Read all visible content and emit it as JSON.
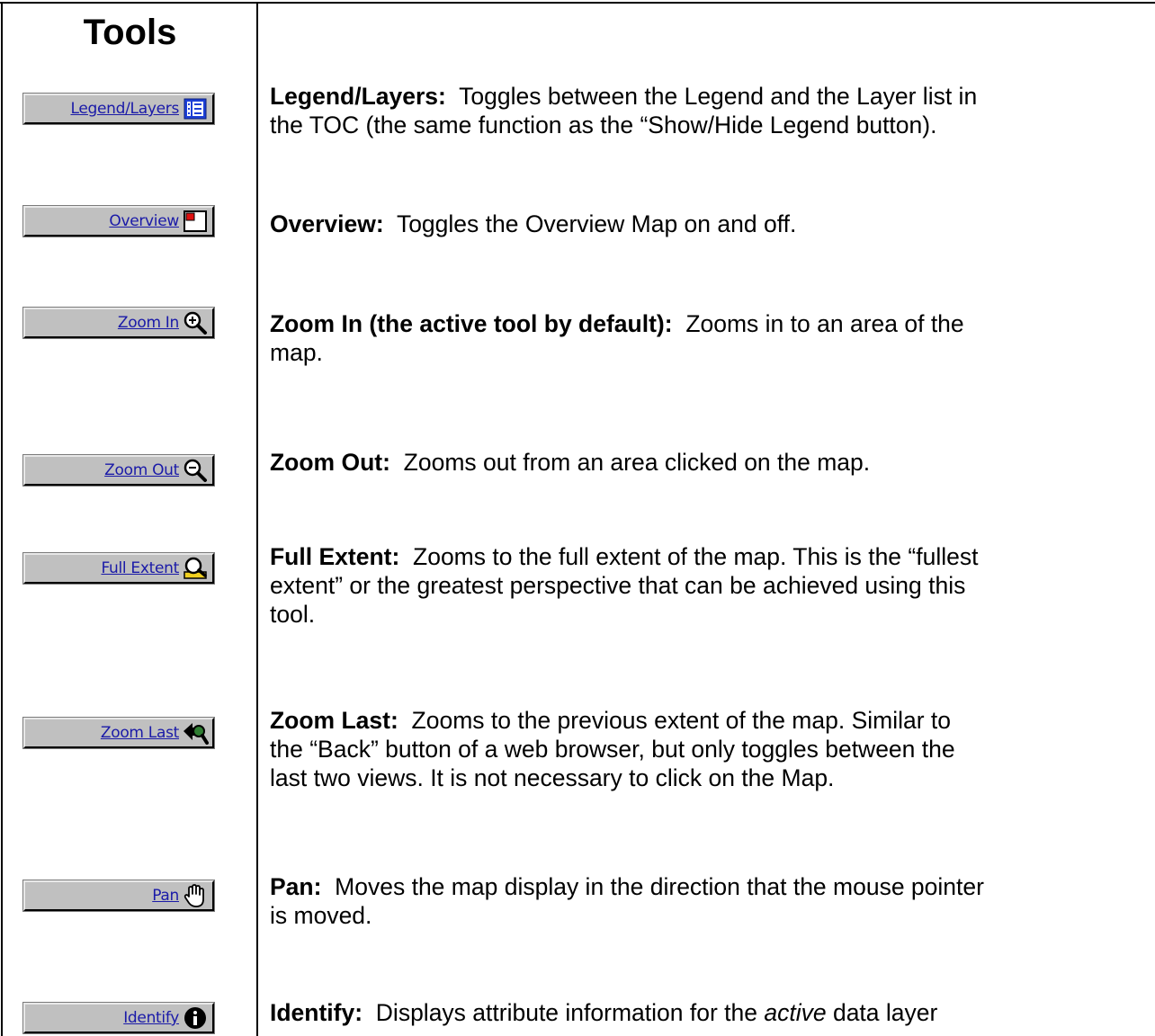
{
  "heading": "Tools",
  "tools": [
    {
      "button_label": "Legend/Layers",
      "icon": "legend-list-icon",
      "title": "Legend/Layers:",
      "lines": [
        "Toggles between the Legend and the Layer list in",
        "the TOC (the same function as the “Show/Hide Legend button)."
      ]
    },
    {
      "button_label": "Overview",
      "icon": "overview-map-icon",
      "title": "Overview:",
      "lines": [
        "Toggles the Overview Map on and off."
      ]
    },
    {
      "button_label": "Zoom In",
      "icon": "zoom-in-icon",
      "title": "Zoom In (the active tool by default):",
      "lines": [
        "Zooms in to an area of the",
        "map."
      ]
    },
    {
      "button_label": "Zoom Out",
      "icon": "zoom-out-icon",
      "title": "Zoom Out:",
      "lines": [
        "Zooms out from an area clicked on the map."
      ]
    },
    {
      "button_label": "Full Extent",
      "icon": "full-extent-icon",
      "title": "Full Extent:",
      "lines": [
        "Zooms to the full extent of the map.  This is the “fullest",
        "extent” or the greatest perspective that can be achieved using this",
        "tool."
      ]
    },
    {
      "button_label": "Zoom Last",
      "icon": "zoom-last-icon",
      "title": "Zoom Last:",
      "lines": [
        "Zooms to the previous extent of the map.  Similar to",
        "the “Back” button of a web browser, but only toggles between the",
        "last two views.  It is not necessary to click on the Map."
      ]
    },
    {
      "button_label": "Pan",
      "icon": "pan-hand-icon",
      "title": "Pan:",
      "lines": [
        "Moves the map display in the direction that the mouse pointer",
        "is moved."
      ]
    },
    {
      "button_label": "Identify",
      "icon": "identify-info-icon",
      "title": "Identify:",
      "lines": [
        "Displays attribute information for the ",
        "active",
        " data layer"
      ]
    }
  ]
}
